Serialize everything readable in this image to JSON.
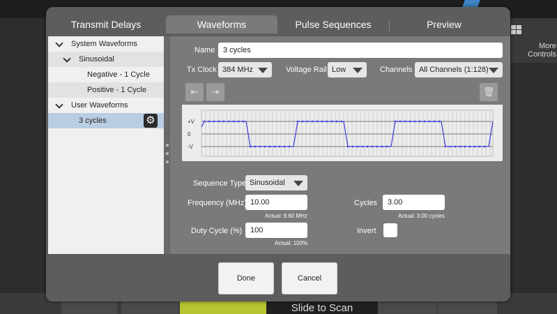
{
  "background": {
    "more_controls": "More Controls",
    "slide_to_scan": "Slide to Scan"
  },
  "tabs": [
    {
      "label": "Transmit Delays",
      "active": false
    },
    {
      "label": "Waveforms",
      "active": true
    },
    {
      "label": "Pulse Sequences",
      "active": false
    },
    {
      "label": "Preview",
      "active": false
    }
  ],
  "tree": [
    {
      "label": "System Waveforms",
      "level": 0,
      "expanded": true
    },
    {
      "label": "Sinusoidal",
      "level": 1,
      "expanded": true
    },
    {
      "label": "Negative - 1 Cycle",
      "level": 2
    },
    {
      "label": "Positive - 1 Cycle",
      "level": 2
    },
    {
      "label": "User Waveforms",
      "level": 0,
      "expanded": true
    },
    {
      "label": "3 cycles",
      "level": 1,
      "selected": true
    }
  ],
  "form": {
    "name_label": "Name",
    "name_value": "3 cycles",
    "tx_clock_label": "Tx Clock",
    "tx_clock_value": "384 MHz",
    "voltage_rail_label": "Voltage Rail",
    "voltage_rail_value": "Low",
    "channels_label": "Channels",
    "channels_value": "All Channels (1:128)",
    "sequence_type_label": "Sequence Type",
    "sequence_type_value": "Sinusoidal",
    "frequency_label": "Frequency (MHz)",
    "frequency_value": "10.00",
    "frequency_actual": "Actual: 9.60 MHz",
    "cycles_label": "Cycles",
    "cycles_value": "3.00",
    "cycles_actual": "Actual: 3.00 cycles",
    "duty_cycle_label": "Duty Cycle (%)",
    "duty_cycle_value": "100",
    "duty_cycle_actual": "Actual: 100%",
    "invert_label": "Invert",
    "invert_checked": false
  },
  "waveform": {
    "y_labels": [
      "+V",
      "0",
      "-V"
    ],
    "line_color": "#3b3bd6"
  },
  "buttons": {
    "done": "Done",
    "cancel": "Cancel"
  }
}
